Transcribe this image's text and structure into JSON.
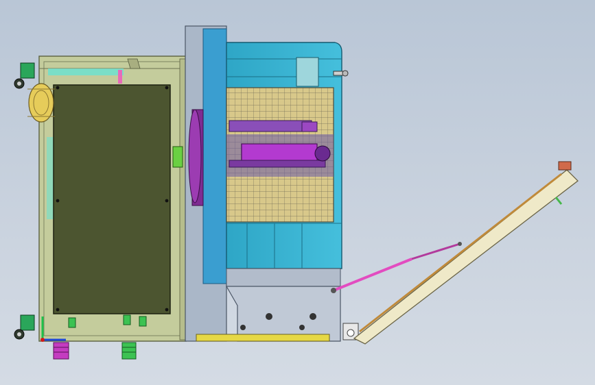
{
  "scene": {
    "kind": "cad-assembly-side-view",
    "has_text": false,
    "colors": {
      "background_top": "#b9c6d6",
      "background_bottom": "#d4dbe4",
      "left_cabinet": "#c4cc9c",
      "control_panel": "#4c5530",
      "teal_housing": "#3fb3cf",
      "teal_dark": "#1f8ea8",
      "grid_panel": "#d8c88a",
      "magenta": "#b43bc4",
      "purple": "#6a5aa8",
      "green_connector": "#36c04a",
      "cream_lid": "#efe9c8",
      "pink_strut": "#e24cc0",
      "yellow_strip": "#e6d845"
    },
    "icons": [
      "caster-wheel-icon",
      "axis-triad-icon"
    ]
  }
}
